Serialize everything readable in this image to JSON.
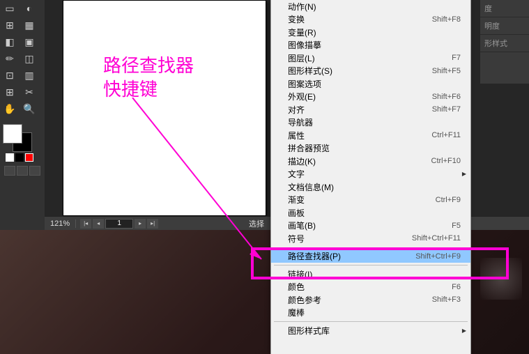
{
  "annotation": {
    "line1": "路径查找器",
    "line2": "快捷键"
  },
  "status": {
    "zoom": "121%",
    "page": "1",
    "select_text": "选择"
  },
  "right_panels": [
    "度",
    "明度",
    "形样式"
  ],
  "menu": [
    {
      "label": "动作(N)",
      "shortcut": "",
      "arrow": false
    },
    {
      "label": "变换",
      "shortcut": "Shift+F8",
      "arrow": false
    },
    {
      "label": "变量(R)",
      "shortcut": "",
      "arrow": false
    },
    {
      "label": "图像描摹",
      "shortcut": "",
      "arrow": false
    },
    {
      "label": "图层(L)",
      "shortcut": "F7",
      "arrow": false
    },
    {
      "label": "图形样式(S)",
      "shortcut": "Shift+F5",
      "arrow": false
    },
    {
      "label": "图案选项",
      "shortcut": "",
      "arrow": false
    },
    {
      "label": "外观(E)",
      "shortcut": "Shift+F6",
      "arrow": false
    },
    {
      "label": "对齐",
      "shortcut": "Shift+F7",
      "arrow": false
    },
    {
      "label": "导航器",
      "shortcut": "",
      "arrow": false
    },
    {
      "label": "属性",
      "shortcut": "Ctrl+F11",
      "arrow": false
    },
    {
      "label": "拼合器预览",
      "shortcut": "",
      "arrow": false
    },
    {
      "label": "描边(K)",
      "shortcut": "Ctrl+F10",
      "arrow": false
    },
    {
      "label": "文字",
      "shortcut": "",
      "arrow": true
    },
    {
      "label": "文档信息(M)",
      "shortcut": "",
      "arrow": false
    },
    {
      "label": "渐变",
      "shortcut": "Ctrl+F9",
      "arrow": false
    },
    {
      "label": "画板",
      "shortcut": "",
      "arrow": false
    },
    {
      "label": "画笔(B)",
      "shortcut": "F5",
      "arrow": false
    },
    {
      "label": "符号",
      "shortcut": "Shift+Ctrl+F11",
      "arrow": false
    },
    {
      "label": "",
      "shortcut": "",
      "sep": true
    },
    {
      "label": "路径查找器(P)",
      "shortcut": "Shift+Ctrl+F9",
      "arrow": false,
      "hl": true
    },
    {
      "label": "",
      "shortcut": "",
      "sep": true
    },
    {
      "label": "链接(I)",
      "shortcut": "",
      "arrow": false
    },
    {
      "label": "颜色",
      "shortcut": "F6",
      "arrow": false
    },
    {
      "label": "颜色参考",
      "shortcut": "Shift+F3",
      "arrow": false
    },
    {
      "label": "魔棒",
      "shortcut": "",
      "arrow": false
    },
    {
      "label": "",
      "shortcut": "",
      "sep": true
    },
    {
      "label": "图形样式库",
      "shortcut": "",
      "arrow": true
    }
  ],
  "tools": [
    "✋",
    "⬚",
    "T",
    "/",
    "◻",
    "✏",
    "◐",
    "≡",
    "◧",
    "⬓",
    "⊞",
    "✂",
    "✋",
    "🔍"
  ]
}
